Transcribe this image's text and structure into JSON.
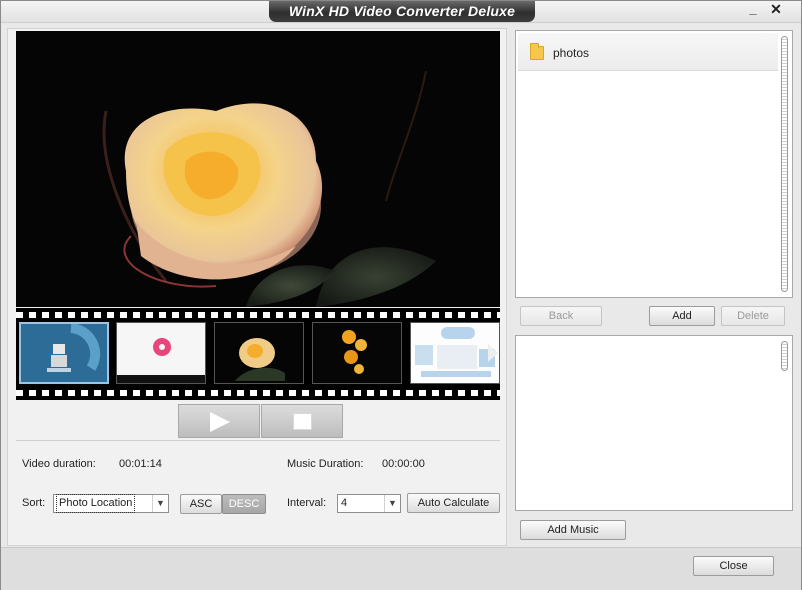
{
  "window": {
    "title": "WinX HD Video Converter Deluxe",
    "minimize_glyph": "_",
    "close_glyph": "✕"
  },
  "colors": {
    "title_tab": "#3a3a3a",
    "preview_bg": "#050505",
    "folder_icon": "#f5c84c",
    "desc_active": "#b0b0b0"
  },
  "player": {
    "play_icon": "play-icon",
    "stop_icon": "stop-icon"
  },
  "info": {
    "video_duration_label": "Video duration:",
    "video_duration_value": "00:01:14",
    "music_duration_label": "Music Duration:",
    "music_duration_value": "00:00:00"
  },
  "sort": {
    "label": "Sort:",
    "selected": "Photo Location",
    "asc_label": "ASC",
    "desc_label": "DESC"
  },
  "interval": {
    "label": "Interval:",
    "selected": "4",
    "auto_label": "Auto Calculate"
  },
  "folders": {
    "items": [
      {
        "name": "photos",
        "icon": "folder-icon"
      }
    ]
  },
  "folder_actions": {
    "back_label": "Back",
    "add_label": "Add",
    "delete_label": "Delete"
  },
  "music": {
    "add_label": "Add Music"
  },
  "footer": {
    "close_label": "Close"
  }
}
